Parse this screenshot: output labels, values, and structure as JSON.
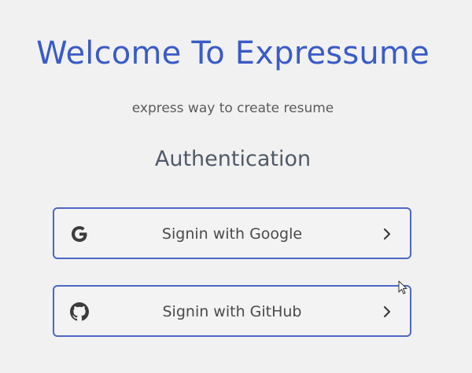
{
  "header": {
    "title": "Welcome To Expressume",
    "subtitle": "express way to create resume"
  },
  "auth": {
    "heading": "Authentication",
    "buttons": [
      {
        "label": "Signin with Google",
        "icon": "google-icon",
        "trailing_icon": "chevron-right-icon"
      },
      {
        "label": "Signin with GitHub",
        "icon": "github-icon",
        "trailing_icon": "chevron-right-icon"
      }
    ]
  },
  "colors": {
    "background": "#f1f1f1",
    "title": "#3a5bc7",
    "button_border": "#4c67c6",
    "text": "#4a4a4a"
  }
}
